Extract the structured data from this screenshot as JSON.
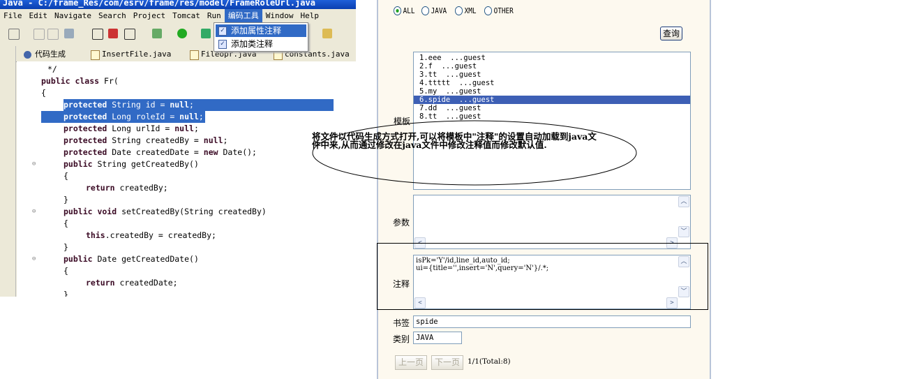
{
  "ide": {
    "title": "Java - C:/frame_Res/com/esrv/frame/res/model/FrameRoleUrl.java",
    "menu": [
      "File",
      "Edit",
      "Navigate",
      "Search",
      "Project",
      "Tomcat",
      "Run",
      "编码工具",
      "Window",
      "Help"
    ],
    "dropdown": [
      "添加属性注释",
      "添加类注释"
    ],
    "tabs": [
      "代码生成",
      "InsertFile.java",
      "Fileopr.java",
      "constants.java"
    ],
    "code": [
      {
        "indent": 1,
        "text": "*/"
      },
      {
        "indent": 0,
        "kw": "public class",
        "text": " Fr("
      },
      {
        "indent": 0,
        "text": "{"
      },
      {
        "indent": 1,
        "kw": "protected",
        "text": " String id = ",
        "kw2": "null",
        ";": ";",
        "sel": true
      },
      {
        "indent": 1,
        "kw": "protected",
        "text": " Long roleId = ",
        "kw2": "null",
        "sel": true
      },
      {
        "indent": 1,
        "kw": "protected",
        "text": " Long urlId = ",
        "kw2": "null"
      },
      {
        "indent": 1,
        "kw": "protected",
        "text": " String createdBy = ",
        "kw2": "null"
      },
      {
        "indent": 1,
        "kw": "protected",
        "text": " Date createdDate = ",
        "kw2": "new",
        "tail": " Date();"
      },
      {
        "indent": 1,
        "kw": "public",
        "text": " String getCreatedBy()",
        "fold": true
      },
      {
        "indent": 1,
        "text": "{"
      },
      {
        "indent": 2,
        "kw": "return",
        "text": " createdBy;"
      },
      {
        "indent": 1,
        "text": "}"
      },
      {
        "indent": 1,
        "kw": "public void",
        "text": " setCreatedBy(String createdBy)",
        "fold": true
      },
      {
        "indent": 1,
        "text": "{"
      },
      {
        "indent": 2,
        "kw": "this",
        "text": ".createdBy = createdBy;"
      },
      {
        "indent": 1,
        "text": "}"
      },
      {
        "indent": 1,
        "kw": "public",
        "text": " Date getCreatedDate()",
        "fold": true
      },
      {
        "indent": 1,
        "text": "{"
      },
      {
        "indent": 2,
        "kw": "return",
        "text": " createdDate;"
      },
      {
        "indent": 1,
        "text": "}"
      }
    ]
  },
  "panel": {
    "radios": [
      {
        "label": "ALL",
        "checked": true
      },
      {
        "label": "JAVA"
      },
      {
        "label": "XML"
      },
      {
        "label": "OTHER"
      }
    ],
    "query_button": "查询",
    "template_label": "模板",
    "templates": [
      "1.eee  ...guest",
      "2.f  ...guest",
      "3.tt  ...guest",
      "4.ttttt  ...guest",
      "5.my  ...guest",
      "6.spide  ...guest",
      "7.dd  ...guest",
      "8.tt  ...guest"
    ],
    "selected_index": 5,
    "params_label": "参数",
    "params_value": "",
    "comment_label": "注释",
    "comment_value": "isPk='Y'/id,line_id,auto_id;\nui={title='',insert='N',query='N'}/.*;",
    "bookmark_label": "书签",
    "bookmark_value": "spide",
    "category_label": "类别",
    "category_value": "JAVA",
    "prev_button": "上一页",
    "next_button": "下一页",
    "page_info": "1/1(Total:8)"
  },
  "annotation": "将文件以代码生成方式打开,可以将模板中\"注释\"的设置自动加载到java文件中来,从而通过修改在java文件中修改注释值而修改默认值."
}
